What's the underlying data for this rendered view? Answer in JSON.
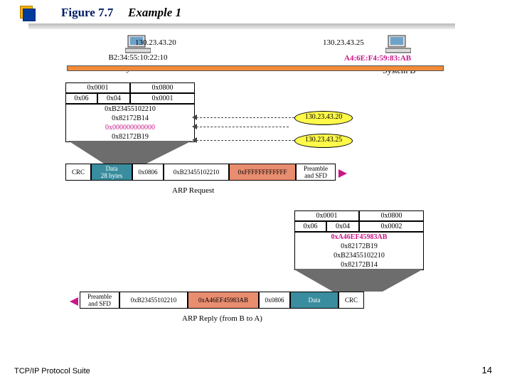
{
  "title": {
    "fig": "Figure 7.7",
    "ex": "Example 1"
  },
  "footer": {
    "left": "TCP/IP Protocol Suite",
    "page": "14"
  },
  "hostA": {
    "ip": "130.23.43.20",
    "mac": "B2:34:55:10:22:10",
    "name": "System A"
  },
  "hostB": {
    "ip": "130.23.43.25",
    "mac": "A4:6E:F4:59:83:AB",
    "name": "System B"
  },
  "req": {
    "r1": [
      "0x0001",
      "0x0800"
    ],
    "r2": [
      "0x06",
      "0x04",
      "0x0001"
    ],
    "lines": [
      "0xB23455102210",
      "0x82172B14",
      "0x000000000000",
      "0x82172B19"
    ]
  },
  "reqFrame": {
    "crc": "CRC",
    "data1": "Data",
    "data2": "28 bytes",
    "type": "0x0806",
    "sa": "0xB23455102210",
    "da": "0xFFFFFFFFFFFF",
    "pre1": "Preamble",
    "pre2": "and SFD"
  },
  "reqCap": "ARP Request",
  "ov": {
    "a": "130.23.43.20",
    "b": "130.23.43.25"
  },
  "rep": {
    "r1": [
      "0x0001",
      "0x0800"
    ],
    "r2": [
      "0x06",
      "0x04",
      "0x0002"
    ],
    "lines": [
      "0xA46EF45983AB",
      "0x82172B19",
      "0xB23455102210",
      "0x82172B14"
    ]
  },
  "repFrame": {
    "pre1": "Preamble",
    "pre2": "and SFD",
    "da": "0xB23455102210",
    "sa": "0xA46EF45983AB",
    "type": "0x0806",
    "data": "Data",
    "crc": "CRC"
  },
  "repCap": "ARP Reply  (from B to A)"
}
